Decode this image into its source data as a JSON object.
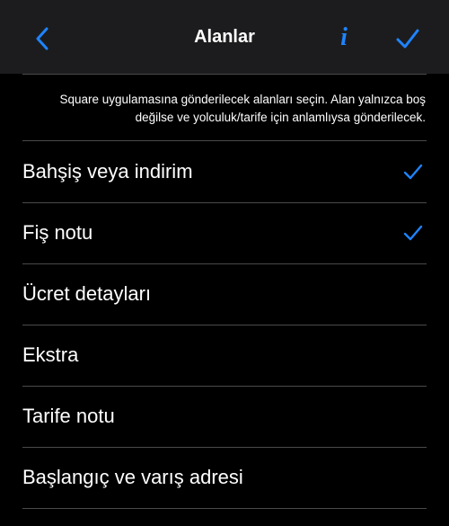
{
  "navbar": {
    "title": "Alanlar",
    "info_glyph": "i",
    "accent_color": "#1e84ff",
    "back_icon": "chevron-left-icon",
    "done_icon": "checkmark-icon"
  },
  "description": "Square uygulamasına gönderilecek alanları seçin. Alan yalnızca boş değilse ve yolculuk/tarife için anlamlıysa gönderilecek.",
  "fields": [
    {
      "label": "Bahşiş veya indirim",
      "checked": true
    },
    {
      "label": "Fiş notu",
      "checked": true
    },
    {
      "label": "Ücret detayları",
      "checked": false
    },
    {
      "label": "Ekstra",
      "checked": false
    },
    {
      "label": "Tarife notu",
      "checked": false
    },
    {
      "label": "Başlangıç ve varış adresi",
      "checked": false
    }
  ]
}
